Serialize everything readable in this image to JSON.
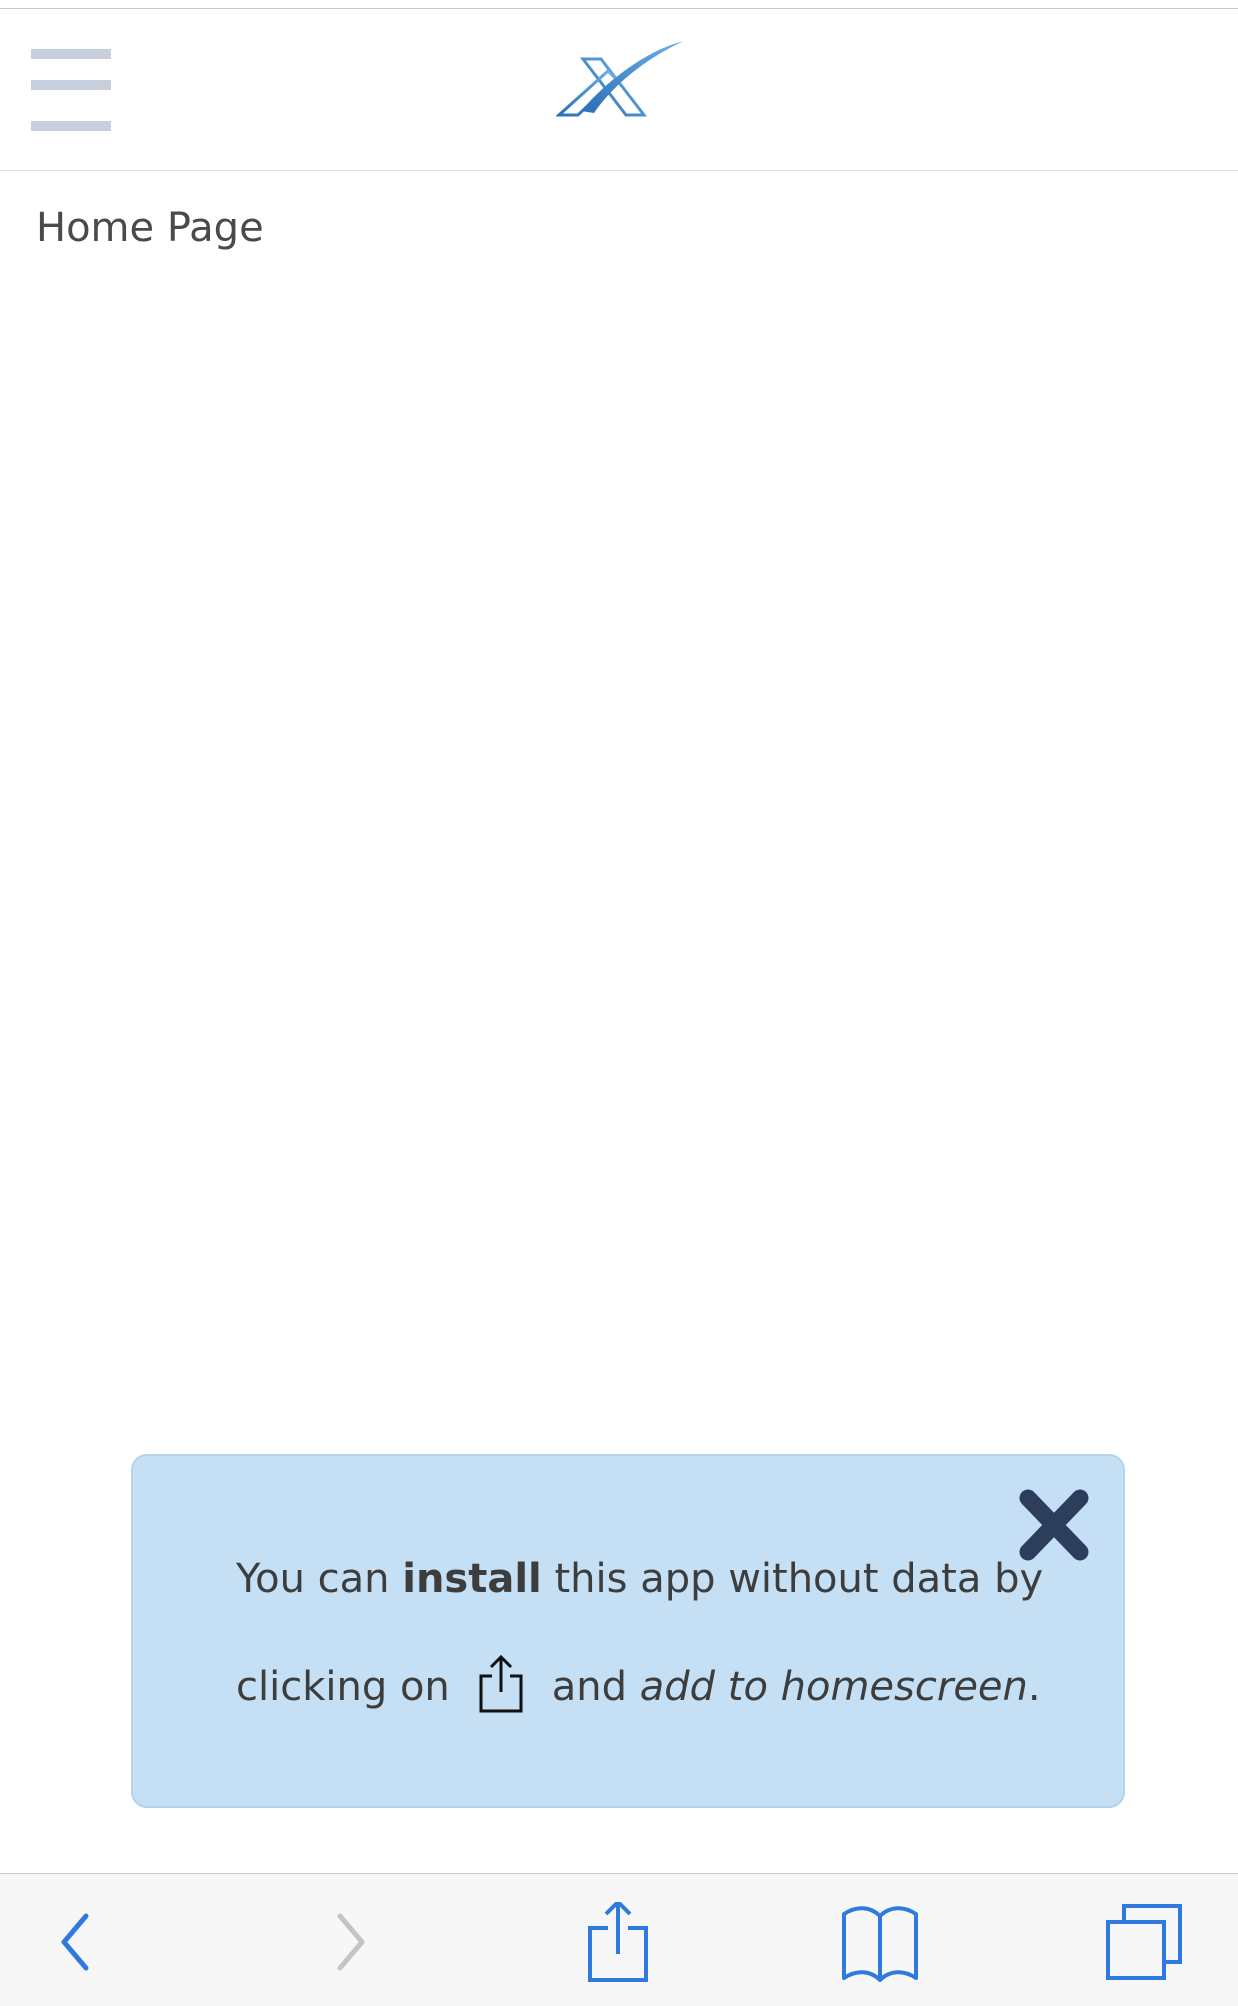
{
  "header": {
    "menu_icon": "hamburger-menu-icon",
    "logo_icon": "x-logo-icon"
  },
  "page": {
    "title": "Home Page"
  },
  "install_banner": {
    "text_prefix": "You can",
    "text_bold": "install",
    "text_rest": "this app without data by",
    "line2_prefix": "clicking on",
    "line2_mid": "and",
    "line2_italic": "add to homescreen",
    "line2_end": ".",
    "close_icon": "close-x-icon",
    "share_icon": "share-icon",
    "background": "#c5e0f4"
  },
  "toolbar": {
    "icons": [
      "back-arrow-icon",
      "forward-arrow-icon",
      "share-icon",
      "bookmarks-icon",
      "tabs-icon"
    ],
    "accent": "#2f7ae0",
    "disabled": "#c4c4c8"
  }
}
